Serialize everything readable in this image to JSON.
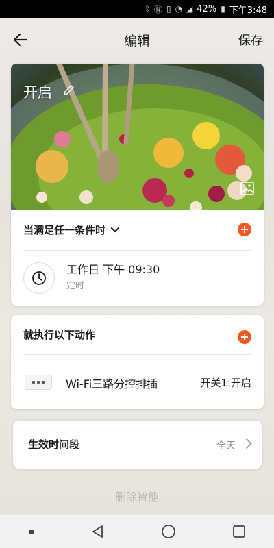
{
  "status_bar": {
    "battery": "42%",
    "time": "下午3:48"
  },
  "header": {
    "title": "编辑",
    "save_label": "保存"
  },
  "scene": {
    "name": "开启"
  },
  "conditions": {
    "label": "当满足任一条件时",
    "item": {
      "title": "工作日 下午 09:30",
      "subtitle": "定时"
    }
  },
  "actions": {
    "label": "就执行以下动作",
    "item": {
      "device": "Wi-Fi三路分控排插",
      "state": "开关1:开启"
    }
  },
  "period": {
    "label": "生效时间段",
    "value": "全天"
  },
  "delete_label": "删除智能",
  "colors": {
    "accent": "#f25a1f",
    "status_bar": "#000000"
  }
}
